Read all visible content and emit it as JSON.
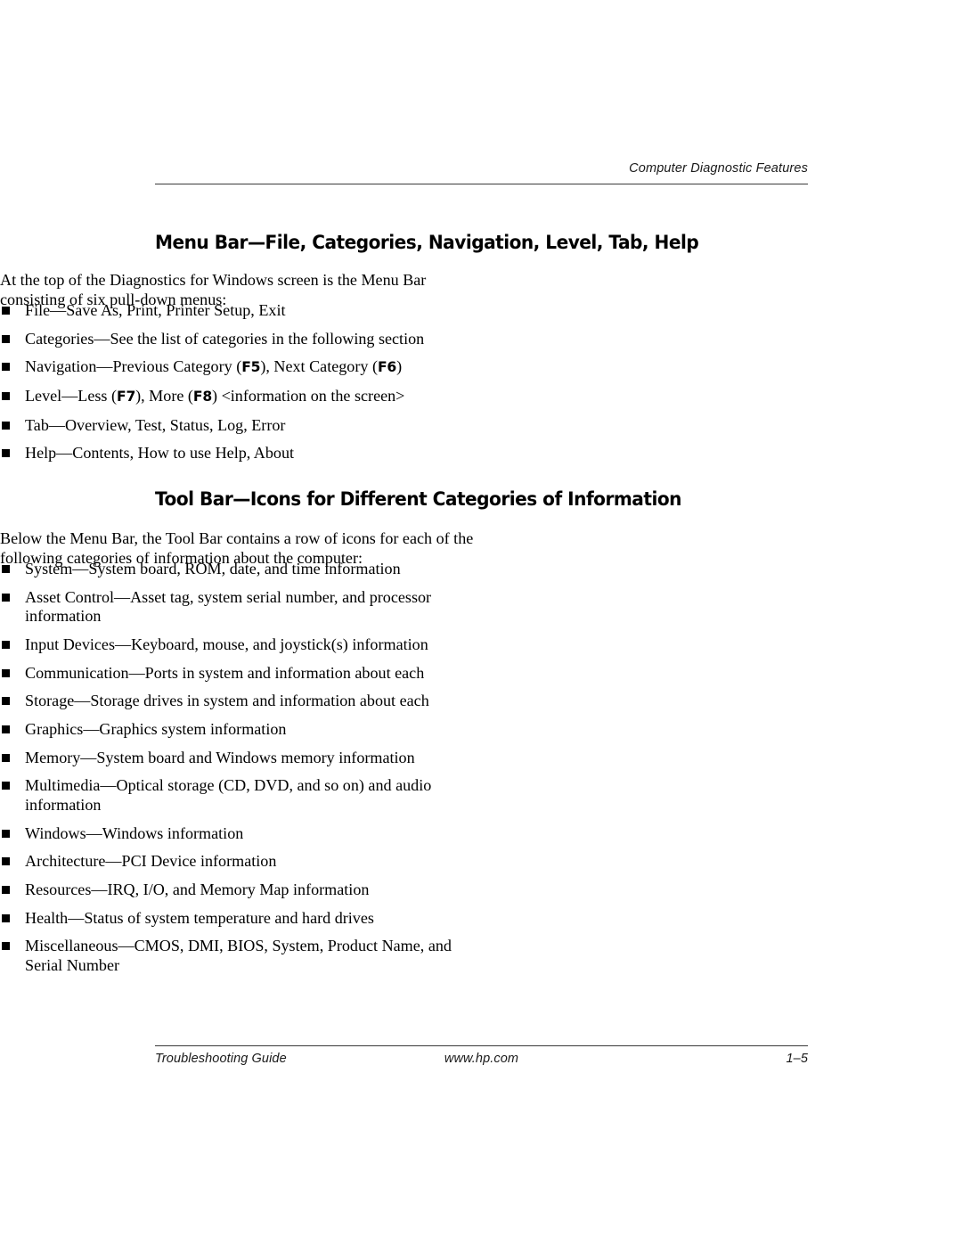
{
  "header": {
    "running_head": "Computer Diagnostic Features"
  },
  "sections": [
    {
      "heading": "Menu Bar—File, Categories, Navigation, Level, Tab, Help",
      "intro": "At the top of the Diagnostics for Windows screen is the Menu Bar consisting of six pull-down menus:",
      "bullets": [
        "File—Save As, Print, Printer Setup, Exit",
        "Categories—See the list of categories in the following section",
        "Navigation—Previous Category (F5), Next Category (F6)",
        "Level—Less (F7), More (F8) <information on the screen>",
        "Tab—Overview, Test, Status, Log, Error",
        "Help—Contents, How to use Help, About"
      ]
    },
    {
      "heading": "Tool Bar—Icons for Different Categories of Information",
      "intro": "Below the Menu Bar, the Tool Bar contains a row of icons for each of the following categories of information about the computer:",
      "bullets": [
        "System—System board, ROM, date, and time information",
        "Asset Control—Asset tag, system serial number, and processor information",
        "Input Devices—Keyboard, mouse, and joystick(s) information",
        "Communication—Ports in system and information about each",
        "Storage—Storage drives in system and information about each",
        "Graphics—Graphics system information",
        "Memory—System board and Windows memory information",
        "Multimedia—Optical storage (CD, DVD, and so on) and audio information",
        "Windows—Windows information",
        "Architecture—PCI Device information",
        "Resources—IRQ, I/O, and Memory Map information",
        "Health—Status of system temperature and hard drives",
        "Miscellaneous—CMOS, DMI, BIOS, System, Product Name, and Serial Number"
      ]
    }
  ],
  "function_keys": [
    "F5",
    "F6",
    "F7",
    "F8"
  ],
  "footer": {
    "left": "Troubleshooting Guide",
    "center": "www.hp.com",
    "right": "1–5"
  },
  "colors": {
    "text": "#000000",
    "rule": "#3a3a3a",
    "muted": "#1a1a1a"
  }
}
